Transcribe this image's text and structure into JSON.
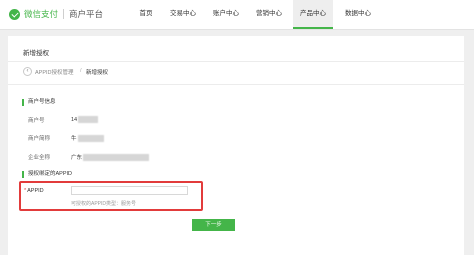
{
  "header": {
    "brand": "微信支付",
    "subtitle": "商户平台",
    "nav": [
      {
        "label": "首页",
        "active": false
      },
      {
        "label": "交易中心",
        "active": false
      },
      {
        "label": "账户中心",
        "active": false
      },
      {
        "label": "营销中心",
        "active": false
      },
      {
        "label": "产品中心",
        "active": true
      },
      {
        "label": "数据中心",
        "active": false
      }
    ]
  },
  "page": {
    "title": "新增授权",
    "breadcrumb": {
      "parent": "APPID授权管理",
      "separator": "/",
      "current": "新增授权"
    }
  },
  "merchant_info": {
    "heading": "商户号信息",
    "fields": [
      {
        "label": "商户号",
        "value": "14"
      },
      {
        "label": "商户简称",
        "value": "牛"
      },
      {
        "label": "企业全称",
        "value": "广东"
      }
    ]
  },
  "appid_section": {
    "heading": "授权绑定的APPID",
    "label": "APPID",
    "required_mark": "*",
    "input_value": "",
    "hint": "可授权的APPID类型：服务号"
  },
  "actions": {
    "next_label": "下一步"
  },
  "colors": {
    "accent": "#44b549",
    "highlight": "#e23b3b"
  }
}
